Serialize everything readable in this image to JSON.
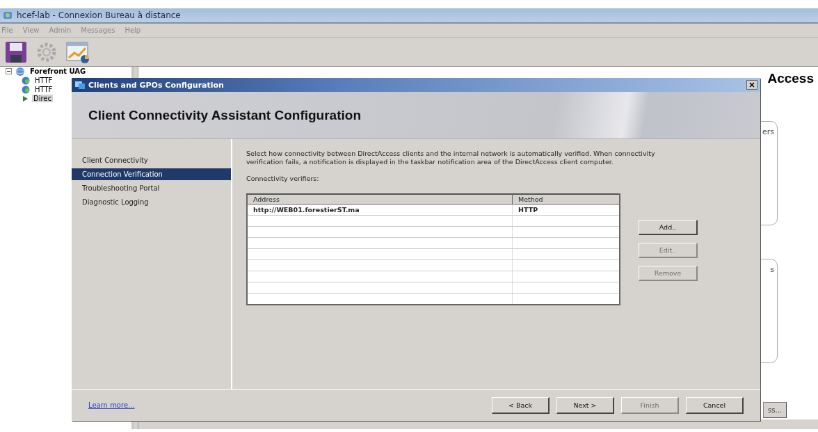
{
  "window": {
    "title": "hcef-lab - Connexion Bureau à distance"
  },
  "menu": [
    "File",
    "View",
    "Admin",
    "Messages",
    "Help"
  ],
  "tree": {
    "label": "Forefront UAG",
    "expanded": true,
    "children": [
      {
        "label": "HTTF",
        "selected": false
      },
      {
        "label": "HTTF",
        "selected": false
      },
      {
        "label": "Direc",
        "selected": true
      }
    ]
  },
  "main_panel": {
    "heading": "Access",
    "group_labels": [
      "ers",
      "s"
    ],
    "button": "ss..."
  },
  "dialog": {
    "title": "Clients and GPOs Configuration",
    "heading": "Client Connectivity Assistant Configuration",
    "nav": [
      {
        "label": "Client Connectivity",
        "selected": false
      },
      {
        "label": "Connection Verification",
        "selected": true
      },
      {
        "label": "Troubleshooting Portal",
        "selected": false
      },
      {
        "label": "Diagnostic Logging",
        "selected": false
      }
    ],
    "description": "Select how connectivity between DirectAccess clients and the internal network is automatically verified. When connectivity verification fails, a notification is displayed in the taskbar notification area of the DirectAccess client computer.",
    "list_label": "Connectivity verifiers:",
    "table": {
      "columns": [
        "Address",
        "Method"
      ],
      "rows": [
        [
          "http://WEB01.forestierST.ma",
          "HTTP"
        ]
      ]
    },
    "side_buttons": [
      {
        "label": "Add..",
        "disabled": false
      },
      {
        "label": "Edit..",
        "disabled": true
      },
      {
        "label": "Remove",
        "disabled": true
      }
    ],
    "learn_more": "Learn more...",
    "buttons": [
      {
        "label": "< Back",
        "disabled": false
      },
      {
        "label": "Next >",
        "disabled": false
      },
      {
        "label": "Finish",
        "disabled": true
      },
      {
        "label": "Cancel",
        "disabled": false
      }
    ]
  }
}
